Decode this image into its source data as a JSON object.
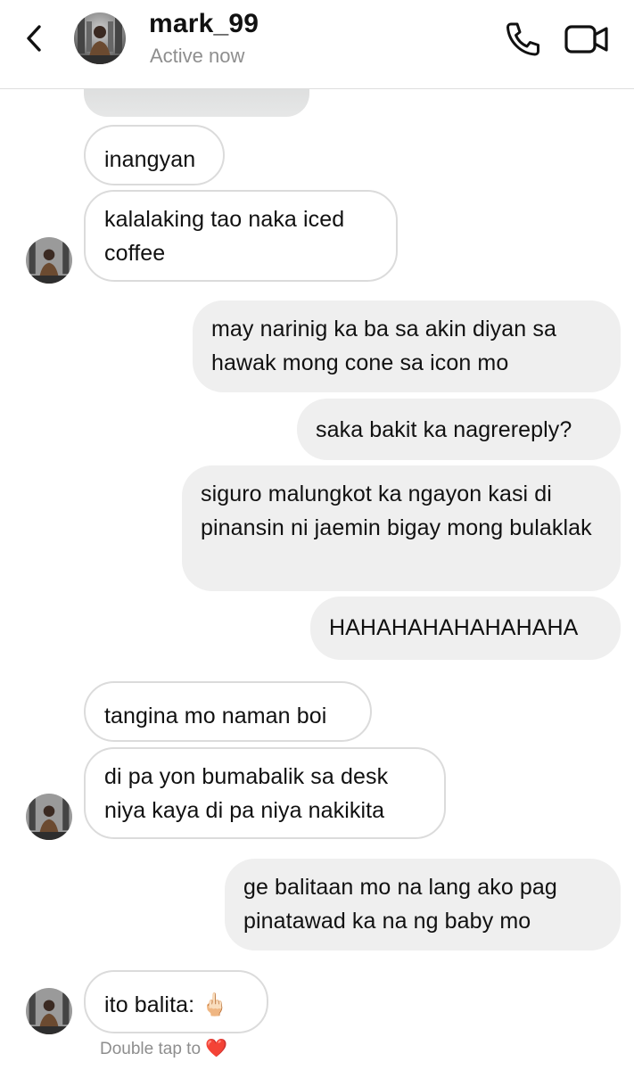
{
  "header": {
    "username": "mark_99",
    "status": "Active now",
    "icons": {
      "back": "chevron-left-icon",
      "call": "phone-icon",
      "video": "video-camera-icon"
    }
  },
  "messages": [
    {
      "side": "in",
      "text": "inangyan"
    },
    {
      "side": "in",
      "text": "kalalaking tao naka iced coffee"
    },
    {
      "side": "out",
      "text": "may narinig ka ba sa akin diyan sa hawak mong cone sa icon mo"
    },
    {
      "side": "out",
      "text": "saka bakit ka nagrereply?"
    },
    {
      "side": "out",
      "text": "siguro malungkot ka ngayon kasi di pinansin ni jaemin bigay mong bulaklak"
    },
    {
      "side": "out",
      "text": "HAHAHAHAHAHAHAHA"
    },
    {
      "side": "in",
      "text": "tangina mo naman boi"
    },
    {
      "side": "in",
      "text": "di pa yon bumabalik sa desk niya kaya di pa niya nakikita"
    },
    {
      "side": "out",
      "text": "ge balitaan mo na lang ako pag pinatawad ka na ng baby mo"
    },
    {
      "side": "in",
      "text": "ito balita: 🖕🏻"
    }
  ],
  "footer": {
    "hint_text": "Double tap to",
    "hint_icon": "❤️"
  },
  "colors": {
    "incoming_bubble_bg": "#ffffff",
    "incoming_bubble_border": "#dbdbdb",
    "outgoing_bubble_bg": "#efefef",
    "secondary_text": "#8e8e8e",
    "heart": "#e0262f"
  }
}
